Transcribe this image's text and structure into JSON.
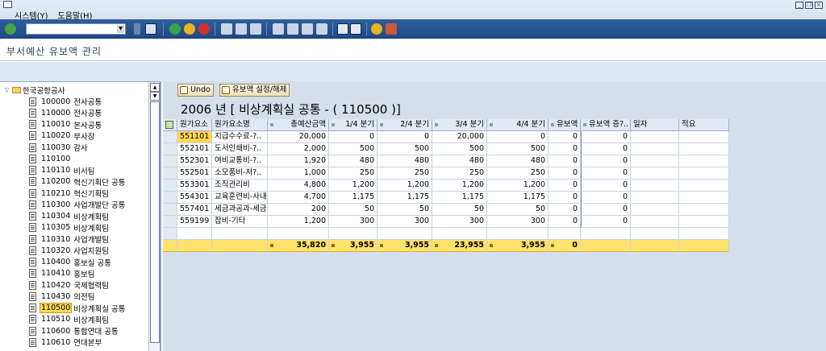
{
  "menu": {
    "items": [
      "시스템(Y)",
      "도움말(H)"
    ]
  },
  "command_field": {
    "value": ""
  },
  "page_title": "부서예산 유보액 관리",
  "tree": {
    "root": "한국공항공사",
    "items": [
      {
        "code": "100000",
        "name": "전사공통"
      },
      {
        "code": "110000",
        "name": "전사공통"
      },
      {
        "code": "110010",
        "name": "본사공통"
      },
      {
        "code": "110020",
        "name": "부사장"
      },
      {
        "code": "110030",
        "name": "감사"
      },
      {
        "code": "110100",
        "name": ""
      },
      {
        "code": "110110",
        "name": "비서팀"
      },
      {
        "code": "110200",
        "name": "혁신기획단 공통"
      },
      {
        "code": "110210",
        "name": "혁신기획팀"
      },
      {
        "code": "110300",
        "name": "사업개발단 공통"
      },
      {
        "code": "110304",
        "name": "비상계획팀"
      },
      {
        "code": "110305",
        "name": "비상계획팀"
      },
      {
        "code": "110310",
        "name": "사업개발팀"
      },
      {
        "code": "110320",
        "name": "사업지원팀"
      },
      {
        "code": "110400",
        "name": "홍보실 공통"
      },
      {
        "code": "110410",
        "name": "홍보팀"
      },
      {
        "code": "110420",
        "name": "국제협력팀"
      },
      {
        "code": "110430",
        "name": "의전팀"
      },
      {
        "code": "110500",
        "name": "비상계획실 공통"
      },
      {
        "code": "110510",
        "name": "비상계획팀"
      },
      {
        "code": "110600",
        "name": "통합연대 공통"
      },
      {
        "code": "110610",
        "name": "연대본부"
      }
    ],
    "selected_index": 18
  },
  "actions": {
    "undo": "Undo",
    "reserve_toggle": "유보액 설정/해제"
  },
  "heading": "2006 년 [ 비상계획실 공통  - ( 110500 )]",
  "table": {
    "headers": [
      "원가요소",
      "원가요소명",
      "총예산금액",
      "1/4 분기",
      "2/4 분기",
      "3/4 분기",
      "4/4 분기",
      "유보액",
      "유보액 증?..",
      "일자",
      "적요"
    ],
    "rows": [
      [
        "551101",
        "지급수수료-?..",
        "20,000",
        "0",
        "0",
        "20,000",
        "0",
        "0",
        "0",
        "",
        ""
      ],
      [
        "552101",
        "도서인쇄비-?..",
        "2,000",
        "500",
        "500",
        "500",
        "500",
        "0",
        "0",
        "",
        ""
      ],
      [
        "552301",
        "여비교통비-?..",
        "1,920",
        "480",
        "480",
        "480",
        "480",
        "0",
        "0",
        "",
        ""
      ],
      [
        "552501",
        "소모품비-저?..",
        "1,000",
        "250",
        "250",
        "250",
        "250",
        "0",
        "0",
        "",
        ""
      ],
      [
        "553301",
        "조직관리비",
        "4,800",
        "1,200",
        "1,200",
        "1,200",
        "1,200",
        "0",
        "0",
        "",
        ""
      ],
      [
        "554301",
        "교육훈련비-사내",
        "4,700",
        "1,175",
        "1,175",
        "1,175",
        "1,175",
        "0",
        "0",
        "",
        ""
      ],
      [
        "557401",
        "세금과공과-세금",
        "200",
        "50",
        "50",
        "50",
        "50",
        "0",
        "0",
        "",
        ""
      ],
      [
        "559199",
        "잡비-기타",
        "1,200",
        "300",
        "300",
        "300",
        "300",
        "0",
        "0",
        "",
        ""
      ]
    ],
    "totals": [
      "35,820",
      "3,955",
      "3,955",
      "23,955",
      "3,955",
      "0"
    ]
  },
  "colors": {
    "toolbar": "#1f4a86",
    "selection": "#ffd74f",
    "totals_row": "#ffe26b"
  }
}
